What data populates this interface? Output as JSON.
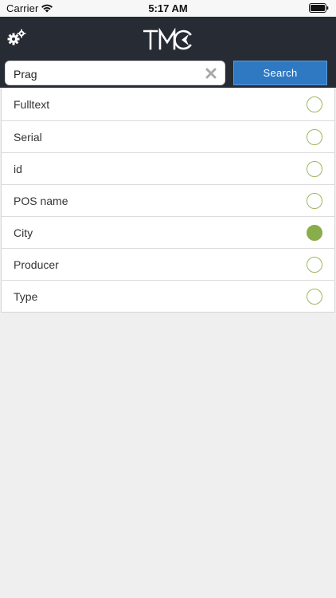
{
  "status_bar": {
    "carrier": "Carrier",
    "time": "5:17 AM"
  },
  "header": {
    "logo_text": "TMC",
    "settings_icon": "gears-icon"
  },
  "search": {
    "value": "Prag",
    "clear_icon": "close-icon",
    "button_label": "Search"
  },
  "options": [
    {
      "label": "Fulltext",
      "selected": false
    },
    {
      "label": "Serial",
      "selected": false
    },
    {
      "label": "id",
      "selected": false
    },
    {
      "label": "POS name",
      "selected": false
    },
    {
      "label": "City",
      "selected": true
    },
    {
      "label": "Producer",
      "selected": false
    },
    {
      "label": "Type",
      "selected": false
    }
  ],
  "colors": {
    "header_bg": "#262b34",
    "accent_blue": "#2f78c2",
    "radio_green": "#8aad4b"
  }
}
